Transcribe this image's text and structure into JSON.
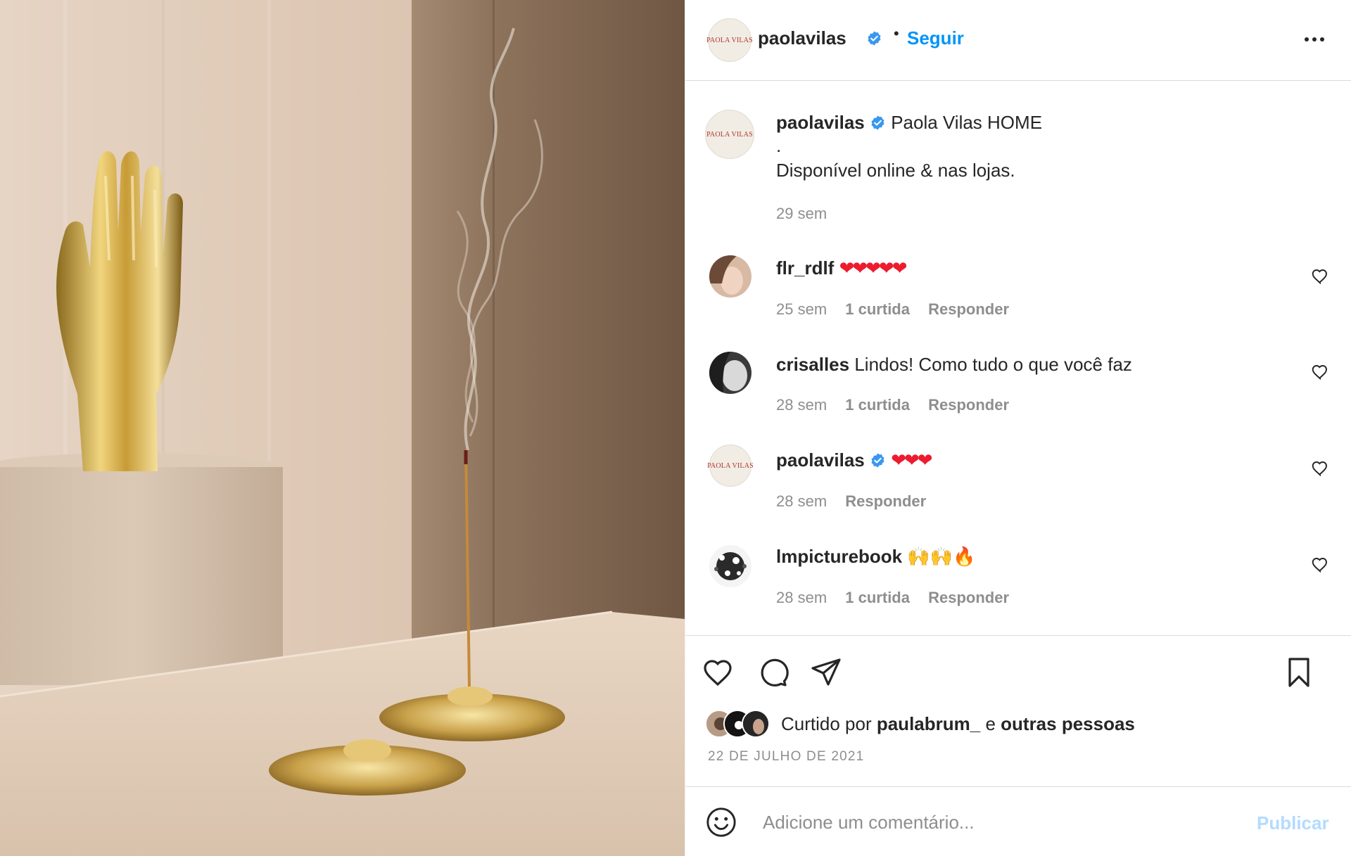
{
  "header": {
    "logo_text": "PAOLA VILAS",
    "username": "paolavilas",
    "separator": "•",
    "follow_label": "Seguir"
  },
  "caption": {
    "username": "paolavilas",
    "title": "Paola Vilas HOME",
    "line2": ".",
    "line3": "Disponível online & nas lojas.",
    "time": "29 sem"
  },
  "comments": [
    {
      "username": "flr_rdlf",
      "text": "❤❤❤❤❤",
      "time": "25 sem",
      "likes": "1 curtida",
      "reply": "Responder"
    },
    {
      "username": "crisalles",
      "text": "Lindos! Como tudo o que você faz",
      "time": "28 sem",
      "likes": "1 curtida",
      "reply": "Responder"
    },
    {
      "username": "paolavilas",
      "text": "❤❤❤",
      "time": "28 sem",
      "likes": "",
      "reply": "Responder"
    },
    {
      "username": "lmpicturebook",
      "text": "🙌🙌🔥",
      "time": "28 sem",
      "likes": "1 curtida",
      "reply": "Responder"
    }
  ],
  "likes": {
    "prefix": "Curtido por ",
    "user": "paulabrum_",
    "middle": " e ",
    "others": "outras pessoas"
  },
  "date": "22 DE JULHO DE 2021",
  "comment_box": {
    "placeholder": "Adicione um comentário...",
    "publish_label": "Publicar"
  },
  "icons": {
    "verified": "verified-badge-icon",
    "more": "more-options-icon",
    "like": "heart-icon",
    "comment": "comment-icon",
    "share": "share-icon",
    "save": "bookmark-icon",
    "emoji": "emoji-icon"
  },
  "colors": {
    "link_blue": "#0095f6",
    "verified_blue": "#3897f0",
    "muted": "#8e8e8e",
    "publish_disabled": "#b3dbff",
    "heart_red": "#ed1b2e"
  }
}
